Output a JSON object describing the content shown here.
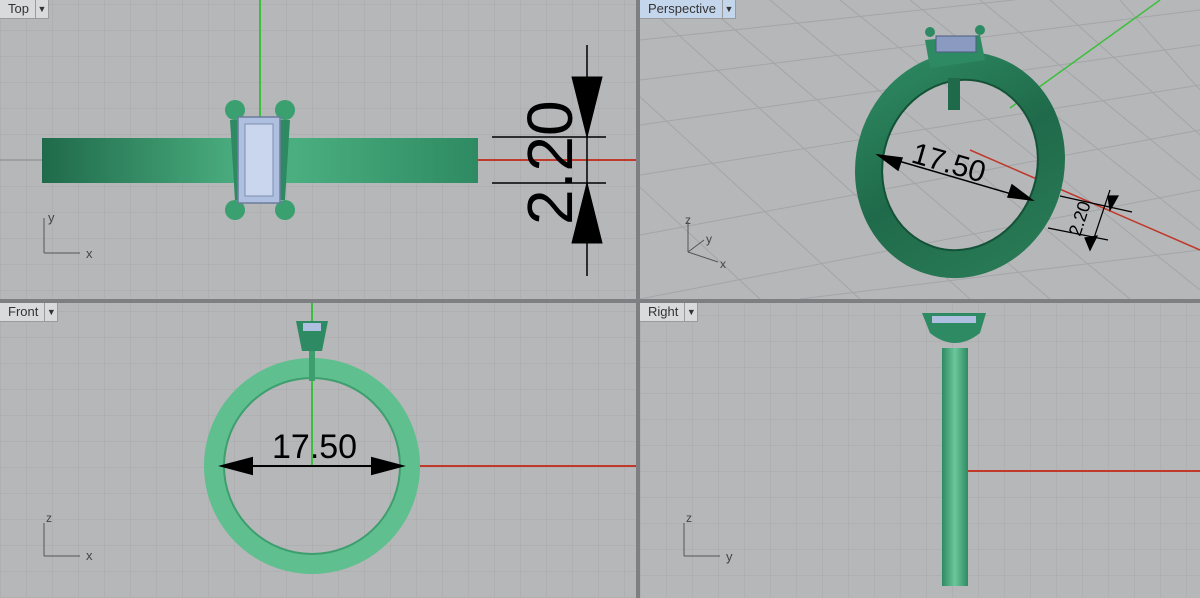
{
  "viewports": {
    "top": {
      "label": "Top"
    },
    "perspective": {
      "label": "Perspective"
    },
    "front": {
      "label": "Front"
    },
    "right": {
      "label": "Right"
    }
  },
  "dimensions": {
    "inner_diameter": "17.50",
    "band_width": "2.20"
  },
  "axis_labels": {
    "x": "x",
    "y": "y",
    "z": "z"
  },
  "dropdown_icon": "chevron-down-icon",
  "colors": {
    "viewport_bg": "#b6b7b9",
    "grid_minor": "#a9aaac",
    "grid_major": "#95979a",
    "x_axis": "#c0392b",
    "y_axis": "#3cbf3c",
    "ring": "#2e8a62",
    "ring_light": "#5fbf8f",
    "ring_dark": "#1f6a4a",
    "gem": "#aebfdf",
    "active_tab": "#c4d6ec"
  }
}
